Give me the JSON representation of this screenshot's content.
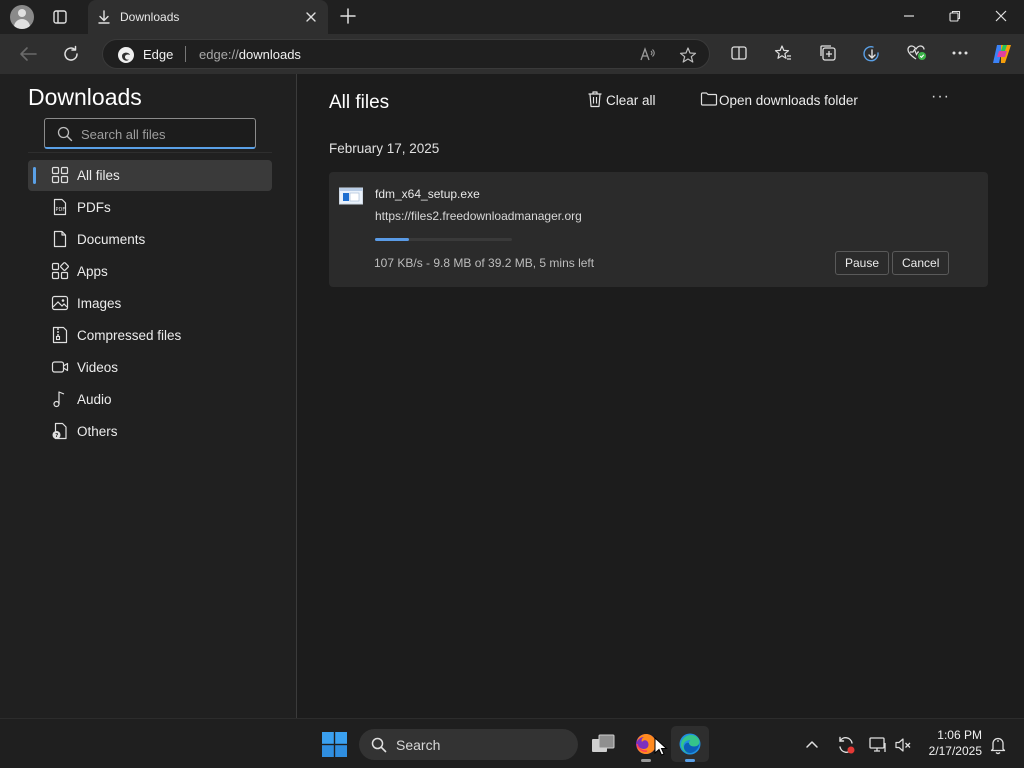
{
  "titlebar": {
    "tab_title": "Downloads",
    "new_tab_symbol": "+"
  },
  "toolbar": {
    "address_label": "Edge",
    "url_scheme": "edge://",
    "url_path": "downloads"
  },
  "sidebar": {
    "title": "Downloads",
    "search_placeholder": "Search all files",
    "items": [
      {
        "label": "All files",
        "icon": "grid-icon",
        "active": true
      },
      {
        "label": "PDFs",
        "icon": "pdf-icon"
      },
      {
        "label": "Documents",
        "icon": "document-icon"
      },
      {
        "label": "Apps",
        "icon": "apps-icon"
      },
      {
        "label": "Images",
        "icon": "image-icon"
      },
      {
        "label": "Compressed files",
        "icon": "archive-icon"
      },
      {
        "label": "Videos",
        "icon": "video-icon"
      },
      {
        "label": "Audio",
        "icon": "music-note-icon"
      },
      {
        "label": "Others",
        "icon": "other-file-icon"
      }
    ]
  },
  "main": {
    "title": "All files",
    "clear_all_label": "Clear all",
    "open_folder_label": "Open downloads folder",
    "more_label": "···",
    "date_group": "February 17, 2025",
    "download": {
      "filename": "fdm_x64_setup.exe",
      "url": "https://files2.freedownloadmanager.org",
      "status": "107 KB/s - 9.8 MB of 39.2 MB, 5 mins left",
      "progress": 0.25,
      "pause_label": "Pause",
      "cancel_label": "Cancel"
    }
  },
  "taskbar": {
    "search_label": "Search",
    "time": "1:06 PM",
    "date": "2/17/2025"
  },
  "colors": {
    "accent": "#5aa0e6",
    "background": "#1c1c1c"
  }
}
